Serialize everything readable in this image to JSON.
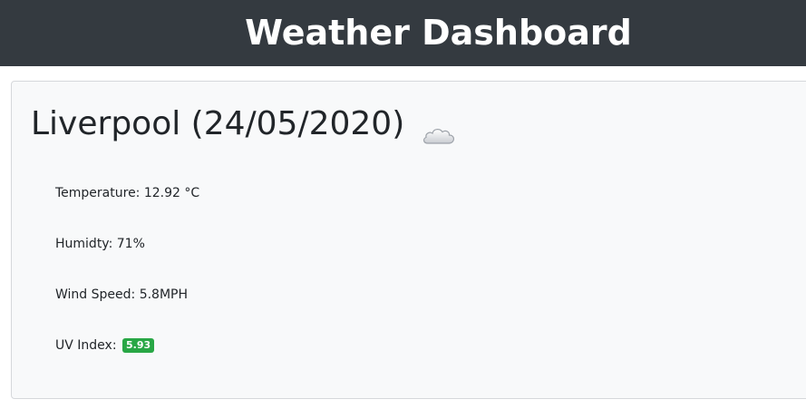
{
  "header": {
    "title": "Weather Dashboard"
  },
  "current": {
    "heading": "Liverpool (24/05/2020)",
    "icon": "cloud-icon",
    "temperature_label": "Temperature:",
    "temperature_value": "12.92 °C",
    "humidity_label": "Humidty:",
    "humidity_value": "71%",
    "wind_label": "Wind Speed:",
    "wind_value": "5.8MPH",
    "uv_label": "UV Index:",
    "uv_value": "5.93",
    "uv_color": "#28a745"
  },
  "colors": {
    "header_bg": "#343a40",
    "card_bg": "#f8f9fa"
  }
}
